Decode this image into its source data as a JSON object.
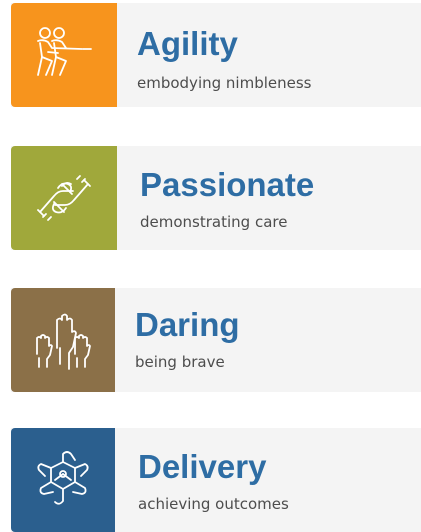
{
  "values": [
    {
      "title": "Agility",
      "subtitle": "embodying nimbleness",
      "icon": "tug-of-war-icon",
      "tile_color": "#f7941d",
      "title_color": "#2e6da4",
      "subtitle_color": "#4d4d4d"
    },
    {
      "title": "Passionate",
      "subtitle": "demonstrating care",
      "icon": "handshake-icon",
      "tile_color": "#a0a83b",
      "title_color": "#2e6da4",
      "subtitle_color": "#4d4d4d"
    },
    {
      "title": "Daring",
      "subtitle": "being brave",
      "icon": "raised-hands-icon",
      "tile_color": "#8b7048",
      "title_color": "#2e6da4",
      "subtitle_color": "#4d4d4d"
    },
    {
      "title": "Delivery",
      "subtitle": "achieving outcomes",
      "icon": "teamwork-hands-icon",
      "tile_color": "#2b5f8e",
      "title_color": "#2e6da4",
      "subtitle_color": "#4d4d4d"
    }
  ]
}
